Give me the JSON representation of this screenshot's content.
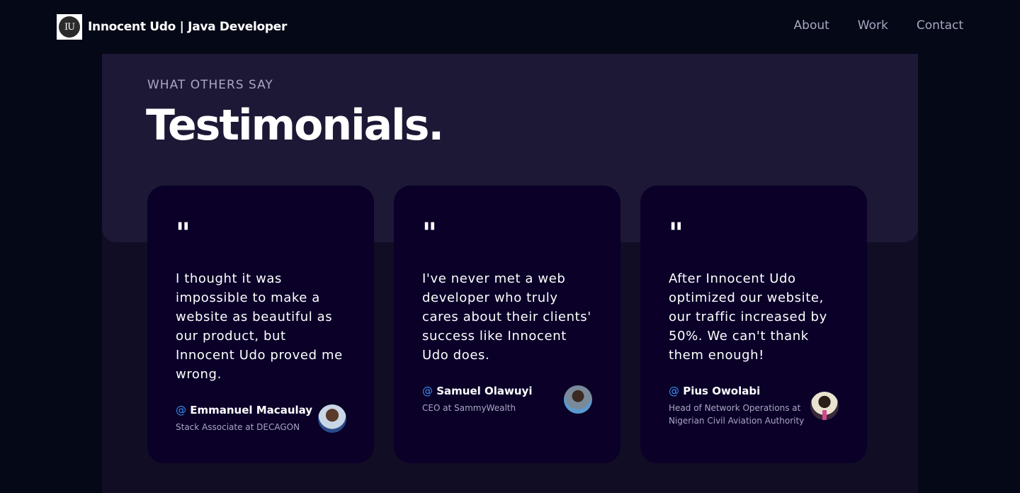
{
  "nav": {
    "logo_text": "IU",
    "brand": "Innocent Udo  | Java Developer",
    "links": [
      "About",
      "Work",
      "Contact"
    ]
  },
  "section": {
    "subheading": "What others say",
    "heading": "Testimonials."
  },
  "testimonials": [
    {
      "quote_mark": "\"",
      "text": "I thought it was impossible to make a website as beautiful as our product, but Innocent Udo proved me wrong.",
      "at": "@",
      "name": "Emmanuel Macaulay",
      "role": "Stack Associate at DECAGON"
    },
    {
      "quote_mark": "\"",
      "text": "I've never met a web developer who truly cares about their clients' success like Innocent Udo does.",
      "at": "@",
      "name": "Samuel Olawuyi",
      "role": "CEO at SammyWealth"
    },
    {
      "quote_mark": "\"",
      "text": "After Innocent Udo optimized our website, our traffic increased by 50%. We can't thank them enough!",
      "at": "@",
      "name": "Pius Owolabi",
      "role": "Head of Network Operations at Nigerian Civil Aviation Authority"
    }
  ],
  "colors": {
    "background": "#050816",
    "panel": "#100d25",
    "panel_top": "#1d1836",
    "card": "#0a0028",
    "secondary_text": "#aaa6c3",
    "accent_blue": "#3a8ff2"
  }
}
